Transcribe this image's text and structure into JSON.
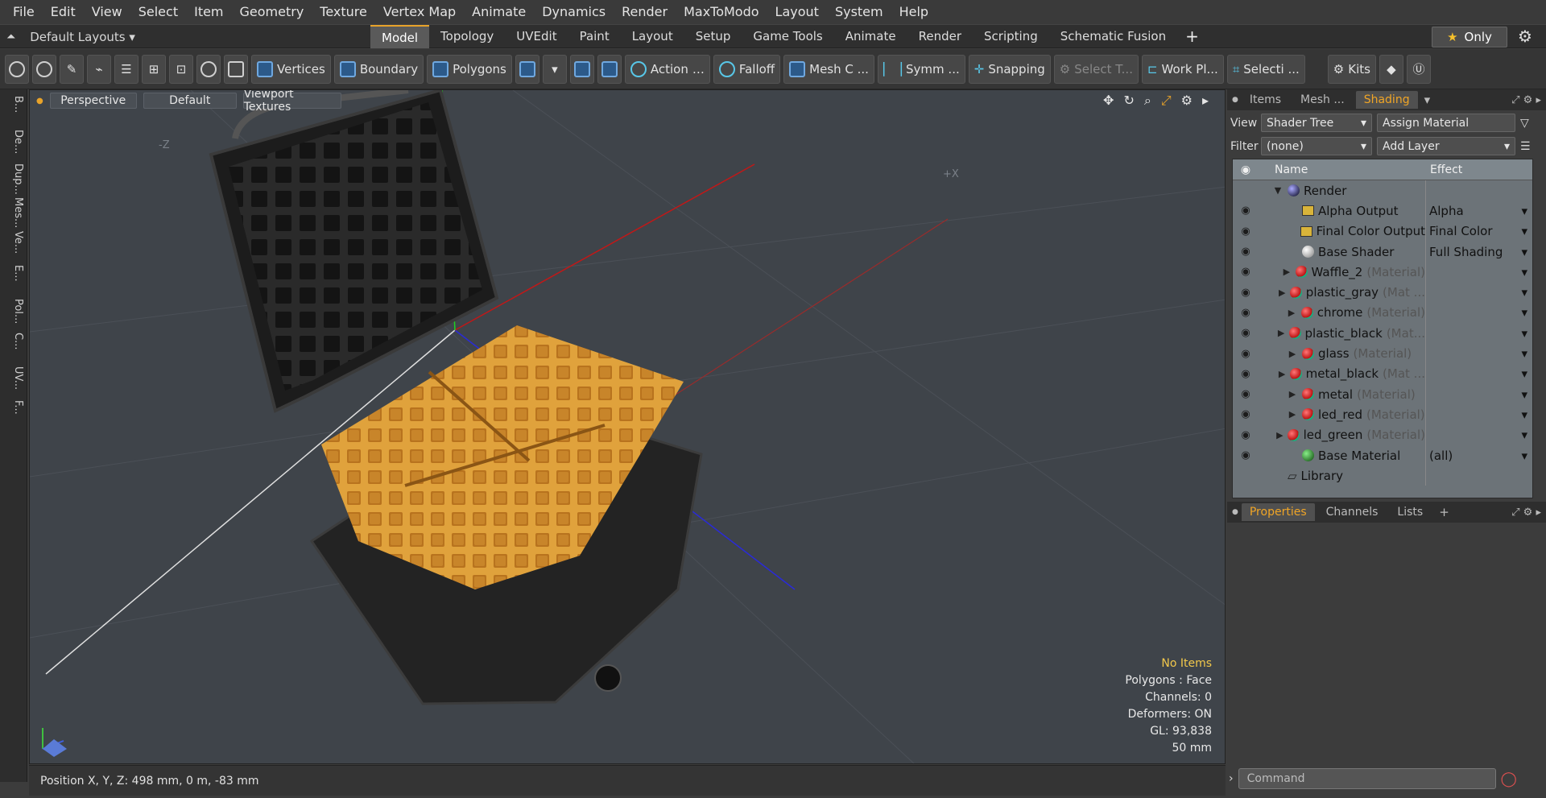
{
  "menu": [
    "File",
    "Edit",
    "View",
    "Select",
    "Item",
    "Geometry",
    "Texture",
    "Vertex Map",
    "Animate",
    "Dynamics",
    "Render",
    "MaxToModo",
    "Layout",
    "System",
    "Help"
  ],
  "layouts": {
    "label": "Default Layouts"
  },
  "tabs": [
    "Model",
    "Topology",
    "UVEdit",
    "Paint",
    "Layout",
    "Setup",
    "Game Tools",
    "Animate",
    "Render",
    "Scripting",
    "Schematic Fusion"
  ],
  "active_tab": "Model",
  "only_label": "Only",
  "toolbar": {
    "vertices": "Vertices",
    "boundary": "Boundary",
    "polygons": "Polygons",
    "action": "Action",
    "falloff": "Falloff",
    "mesh": "Mesh C ...",
    "symm": "Symm ...",
    "snapping": "Snapping",
    "select_t": "Select T...",
    "workpl": "Work Pl...",
    "selecti": "Selecti ...",
    "kits": "Kits"
  },
  "left_strip": [
    "B...",
    "De...",
    "Dup...",
    "Mes...",
    "Ve...",
    "E...",
    "Pol...",
    "C...",
    "UV...",
    "F..."
  ],
  "viewport": {
    "perspective": "Perspective",
    "default": "Default",
    "textures": "Viewport Textures",
    "axis_z": "-Z",
    "axis_x": "+X",
    "info": {
      "noitems": "No Items",
      "polygons": "Polygons : Face",
      "channels": "Channels: 0",
      "deformers": "Deformers: ON",
      "gl": "GL: 93,838",
      "scale": "50 mm"
    }
  },
  "status": {
    "position": "Position X, Y, Z:  498 mm, 0 m, -83 mm"
  },
  "right": {
    "top_tabs": [
      "Items",
      "Mesh ...",
      "Shading"
    ],
    "active_top": "Shading",
    "view_label": "View",
    "view_value": "Shader Tree",
    "assign": "Assign Material",
    "filter_label": "Filter",
    "filter_value": "(none)",
    "add_layer": "Add Layer",
    "col_name": "Name",
    "col_effect": "Effect",
    "rows": [
      {
        "name": "Render",
        "sub": "",
        "effect": "",
        "kind": "blue"
      },
      {
        "name": "Alpha Output",
        "sub": "",
        "effect": "Alpha",
        "kind": "out"
      },
      {
        "name": "Final Color Output",
        "sub": "",
        "effect": "Final Color",
        "kind": "out"
      },
      {
        "name": "Base Shader",
        "sub": "",
        "effect": "Full Shading",
        "kind": "white"
      },
      {
        "name": "Waffle_2",
        "sub": "(Material)",
        "effect": "",
        "kind": "mat"
      },
      {
        "name": "plastic_gray",
        "sub": "(Mat ...",
        "effect": "",
        "kind": "mat"
      },
      {
        "name": "chrome",
        "sub": "(Material)",
        "effect": "",
        "kind": "mat"
      },
      {
        "name": "plastic_black",
        "sub": "(Mat...",
        "effect": "",
        "kind": "mat"
      },
      {
        "name": "glass",
        "sub": "(Material)",
        "effect": "",
        "kind": "mat"
      },
      {
        "name": "metal_black",
        "sub": "(Mat ...",
        "effect": "",
        "kind": "mat"
      },
      {
        "name": "metal",
        "sub": "(Material)",
        "effect": "",
        "kind": "mat"
      },
      {
        "name": "led_red",
        "sub": "(Material)",
        "effect": "",
        "kind": "mat"
      },
      {
        "name": "led_green",
        "sub": "(Material)",
        "effect": "",
        "kind": "mat"
      },
      {
        "name": "Base Material",
        "sub": "",
        "effect": "(all)",
        "kind": "green"
      },
      {
        "name": "Library",
        "sub": "",
        "effect": "",
        "kind": "folder"
      }
    ],
    "bottom_tabs": [
      "Properties",
      "Channels",
      "Lists"
    ],
    "active_bottom": "Properties",
    "command_placeholder": "Command"
  }
}
